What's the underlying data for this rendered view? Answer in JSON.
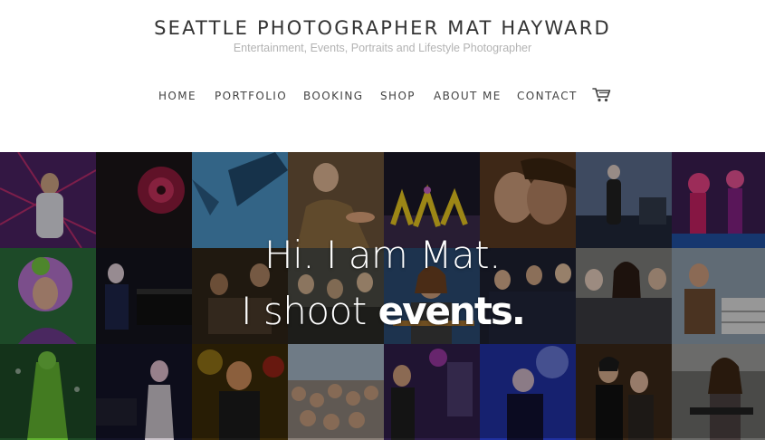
{
  "header": {
    "title": "SEATTLE PHOTOGRAPHER MAT HAYWARD",
    "tagline": "Entertainment, Events, Portraits and Lifestyle Photographer"
  },
  "nav": {
    "items": [
      {
        "label": "HOME"
      },
      {
        "label": "PORTFOLIO"
      },
      {
        "label": "BOOKING"
      },
      {
        "label": "SHOP"
      },
      {
        "label": "ABOUT ME"
      },
      {
        "label": "CONTACT"
      }
    ],
    "cart_icon": "shopping-cart-icon"
  },
  "hero": {
    "line1": "Hi. I am Mat.",
    "line2_prefix": "I shoot ",
    "line2_emphasis": "events."
  },
  "gallery": {
    "rows": 3,
    "columns": 8,
    "palette": [
      [
        "#5a2a6e",
        "#2a1f24",
        "#4a8ec0",
        "#7a5a3a",
        "#1e1a2a",
        "#6a4a2a",
        "#3a4a6a",
        "#5a2a5a"
      ],
      [
        "#3a7a4a",
        "#1a1a2a",
        "#3a2a1a",
        "#5a5a4a",
        "#3a5a7a",
        "#2a2a3a",
        "#6a6a6a",
        "#4a6a5a"
      ],
      [
        "#2a5a2a",
        "#1a1a3a",
        "#4a3a0a",
        "#6a5a4a",
        "#3a2a5a",
        "#2a3a8a",
        "#3a2a1a",
        "#4a4a4a"
      ]
    ]
  }
}
